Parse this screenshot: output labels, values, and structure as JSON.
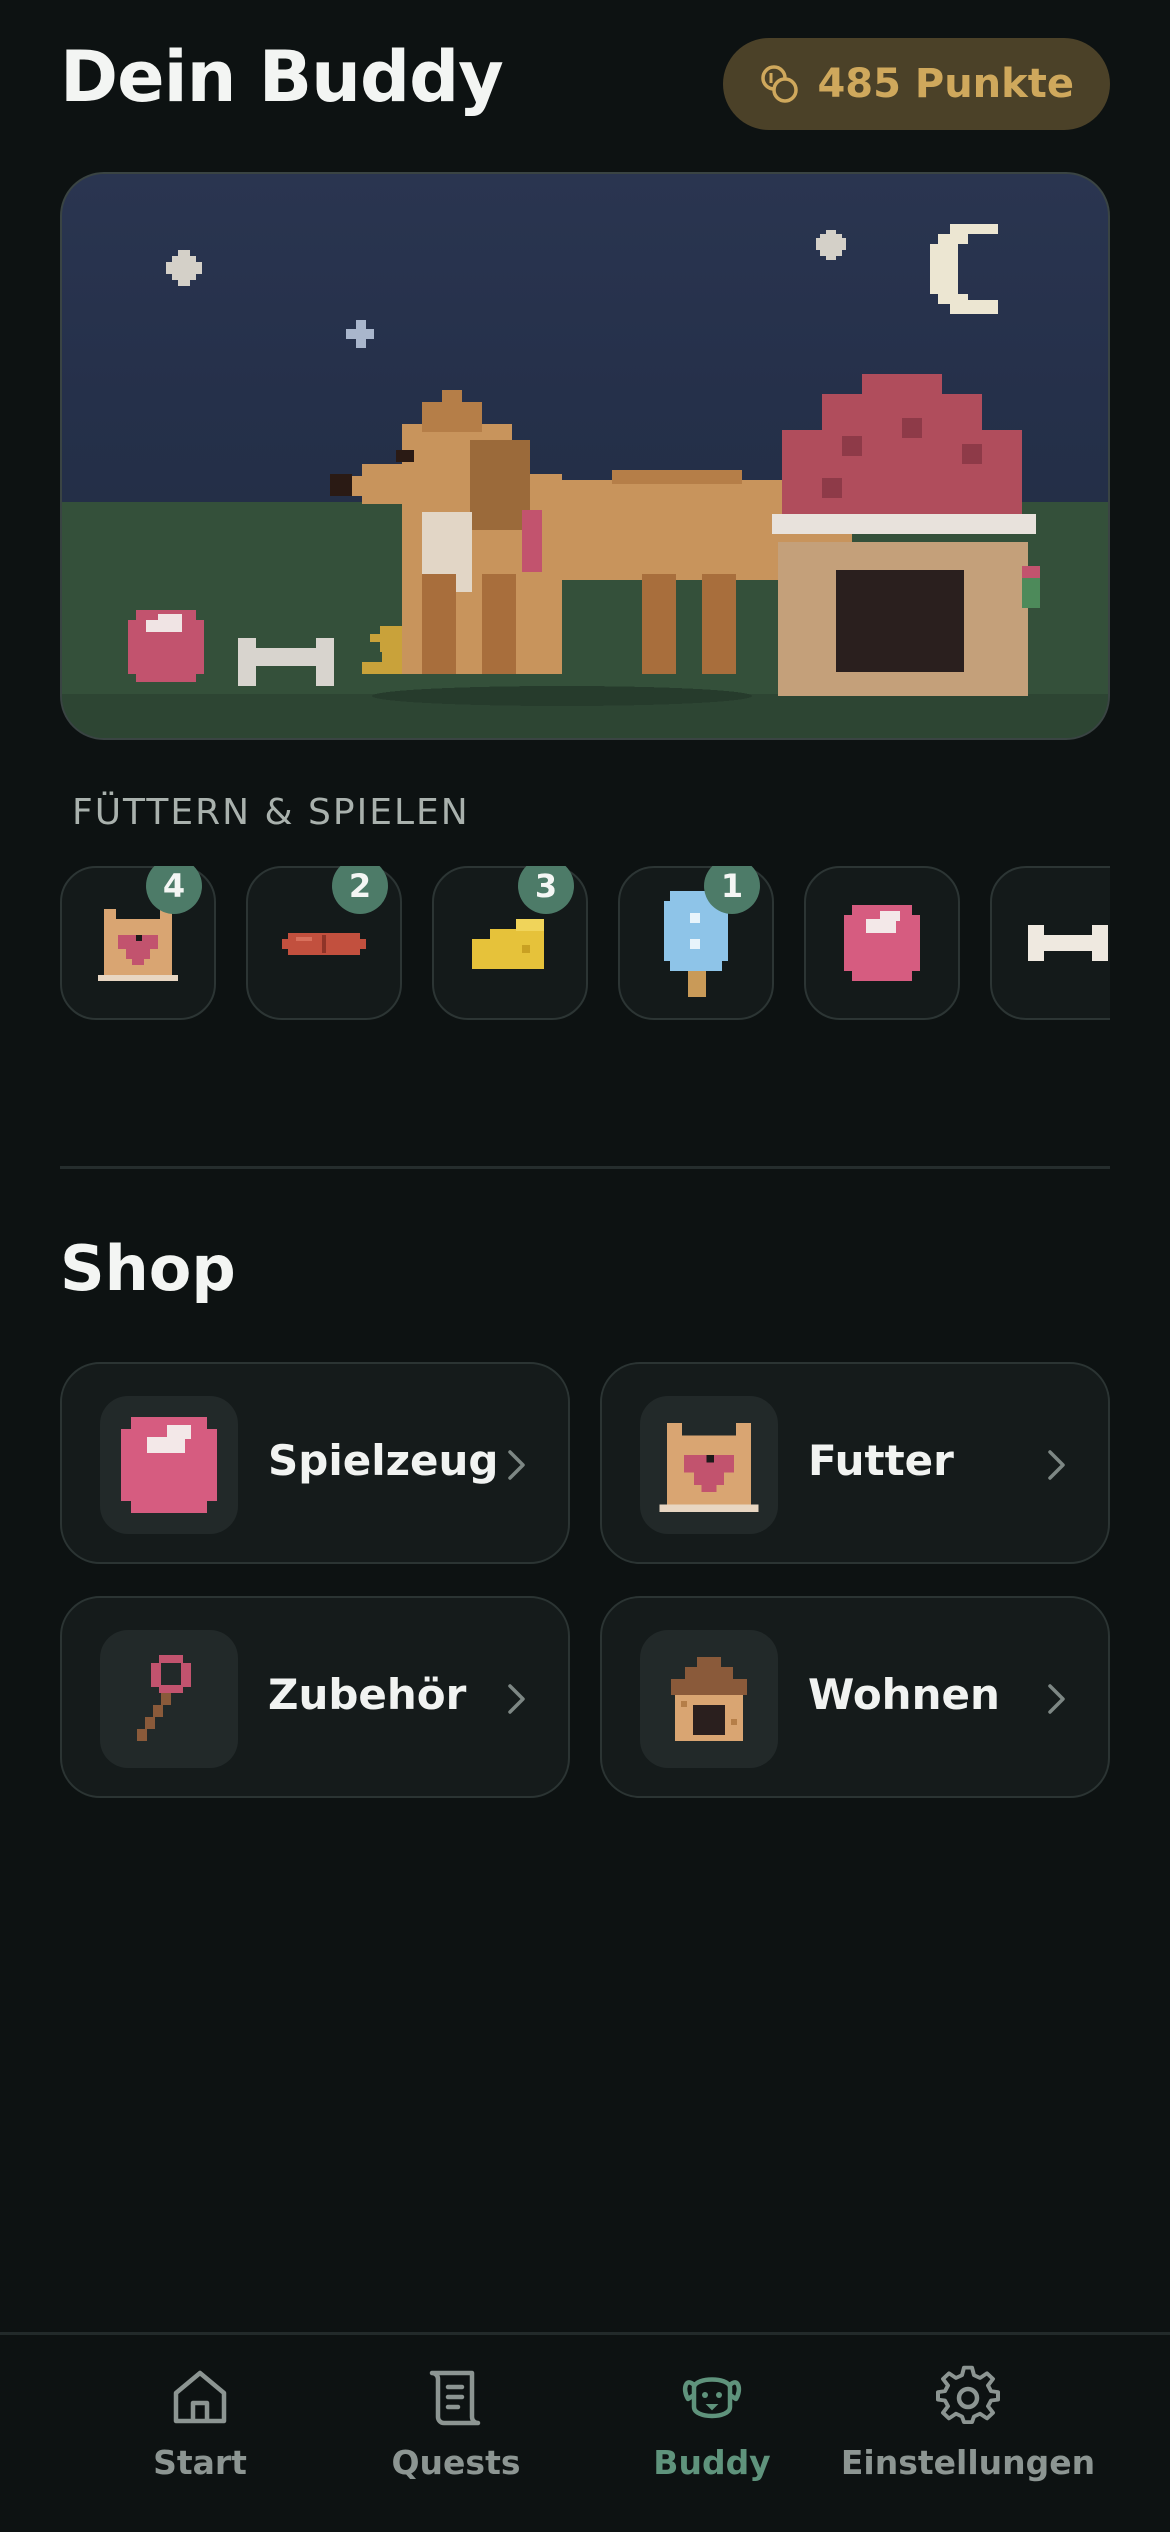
{
  "header": {
    "title": "Dein Buddy",
    "points_label": "485 Punkte"
  },
  "play_section": {
    "label": "FÜTTERN & SPIELEN",
    "items": [
      {
        "icon": "food-bag-icon",
        "count": "4"
      },
      {
        "icon": "sausage-icon",
        "count": "2"
      },
      {
        "icon": "cheese-icon",
        "count": "3"
      },
      {
        "icon": "ice-pop-icon",
        "count": "1"
      },
      {
        "icon": "ball-icon",
        "count": null
      },
      {
        "icon": "bone-icon",
        "count": null
      }
    ]
  },
  "shop": {
    "title": "Shop",
    "categories": [
      {
        "label": "Spielzeug",
        "icon": "ball-icon"
      },
      {
        "label": "Futter",
        "icon": "food-bag-icon"
      },
      {
        "label": "Zubehör",
        "icon": "leash-icon"
      },
      {
        "label": "Wohnen",
        "icon": "dog-house-icon"
      }
    ]
  },
  "nav": {
    "items": [
      {
        "label": "Start",
        "icon": "home-icon",
        "active": false
      },
      {
        "label": "Quests",
        "icon": "scroll-icon",
        "active": false
      },
      {
        "label": "Buddy",
        "icon": "dog-face-icon",
        "active": true
      },
      {
        "label": "Einstellungen",
        "icon": "gear-icon",
        "active": false
      }
    ]
  },
  "colors": {
    "background": "#0d1212",
    "accent_green": "#5f937c",
    "badge_green": "#4d7b68",
    "points_pill": "#4b4128",
    "points_text": "#cfa85c"
  }
}
